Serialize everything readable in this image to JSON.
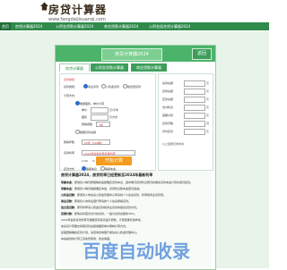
{
  "header": {
    "site_title": "房贷计算器",
    "site_url": "www.fangdaijisuanqi.com"
  },
  "nav": {
    "items": [
      {
        "label": "首页"
      },
      {
        "label": "房贷计算器2024"
      },
      {
        "label": "公积金贷款计算器2024"
      },
      {
        "label": "商业贷款计算器2024"
      },
      {
        "label": "公积金组合贷计算器2024"
      }
    ]
  },
  "panel": {
    "title": "房贷计算器2024",
    "back_label": "返回",
    "tabs": [
      {
        "label": "房贷计算器"
      },
      {
        "label": "公积金贷款计算器"
      },
      {
        "label": "商业贷款计算器"
      }
    ]
  },
  "form": {
    "section_label": "贷款类别：",
    "calc_label": "计算方式：",
    "opt_by_amount": "根据贷款总额",
    "opt_by_area": "根据面积、单价计算",
    "price_label": "单价",
    "area_label": "面积",
    "price_unit": "元/平米",
    "area_unit": "平方米",
    "ratio_label": "按揭成数",
    "ratio_value": "7成",
    "amount_label": "贷款总额",
    "amount_unit": "元",
    "years_label": "按揭年数",
    "years_value": "20年（240期）",
    "rate_label": "贷款利率",
    "rate_value": "2024年最新利率基准利率",
    "rate_num": "4.30",
    "rate_unit": "%",
    "method_label": "还款方式",
    "method_equal_interest": "等额本息",
    "method_equal_principal": "等额本金",
    "loan_type_commercial": "商业贷款",
    "loan_type_fund": "公积金贷款",
    "loan_type_combo": "组合型贷款",
    "calc_button": "开始计算"
  },
  "results": {
    "rows": [
      {
        "label": "房款总额",
        "unit": "元"
      },
      {
        "label": "贷款总额",
        "unit": "元"
      },
      {
        "label": "还款总额",
        "unit": "元"
      },
      {
        "label": "支付利息",
        "unit": "元"
      },
      {
        "label": "首期付款",
        "unit": "元"
      },
      {
        "label": "贷款月数",
        "unit": "月"
      },
      {
        "label": "月均还款",
        "unit": "元"
      }
    ],
    "note": "以上结果仅供参考"
  },
  "article": {
    "title": "房贷计算器2024，房贷利率已经更新至2024年最新利率",
    "lines": [
      {
        "bold": "等额本息：",
        "text": "即借款人每月按相等的金额偿还贷款本息，其中每月贷款利息按月初剩余贷款本金计算并逐月结清。"
      },
      {
        "bold": "等额本金：",
        "text": "即借款人每月等额偿还本金，贷款利息随本金逐月递减。"
      },
      {
        "bold": "公积金贷款：",
        "text": "即借款人向住房公积金管理中心申请的个人住房贷款，利率较商业贷款低。"
      },
      {
        "bold": "商业贷款：",
        "text": "即借款人向商业银行申请的个人住房按揭贷款。"
      },
      {
        "bold": "组合型贷款：",
        "text": "即同时申请公积金贷款和商业贷款的组合贷款方式。"
      },
      {
        "bold": "首期付款：",
        "text": "即购房时首次支付的房款，一般为房款总额的30%。"
      },
      {
        "bold": "",
        "text": "2024年最新贷款利率可根据实际情况进行调整，计算结果仅供参考。"
      },
      {
        "bold": "",
        "text": "本房贷计算器支持按贷款总额或面积单价两种计算方式。"
      },
      {
        "bold": "",
        "text": "如需更精确的还款计划，请咨询当地银行或住房公积金管理中心。"
      },
      {
        "bold": "",
        "text": "本站提供的计算工具免费使用，欢迎收藏。"
      }
    ]
  },
  "watermark": "百度自动收录",
  "colors": {
    "brand_green": "#2f8a4c",
    "panel_green": "#4bb36a",
    "button_orange": "#f39c1f",
    "accent_red": "#d23a3a"
  }
}
